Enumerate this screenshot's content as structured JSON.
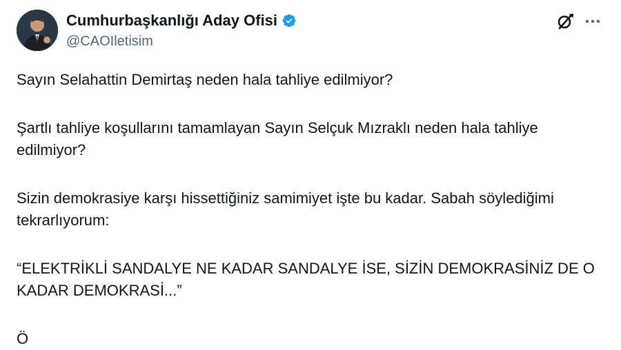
{
  "author": {
    "display_name": "Cumhurbaşkanlığı Aday Ofisi",
    "handle": "@CAOIletisim",
    "verified_color": "#1d9bf0",
    "avatar_icon": "profile-photo"
  },
  "actions": {
    "grok_icon": "slashed-circle-icon",
    "more_icon": "more-horizontal-icon"
  },
  "tweet": {
    "paragraphs": [
      "Sayın Selahattin Demirtaş neden hala tahliye edilmiyor?",
      "Şartlı tahliye koşullarını tamamlayan Sayın Selçuk Mızraklı neden hala tahliye edilmiyor?",
      "Sizin demokrasiye karşı hissettiğiniz samimiyet işte bu kadar. Sabah söylediğimi tekrarlıyorum:",
      "“ELEKTRİKLİ SANDALYE NE KADAR SANDALYE İSE, SİZİN DEMOKRASİNİZ DE O KADAR DEMOKRASİ...”"
    ],
    "cut_off_char": "Ö"
  }
}
